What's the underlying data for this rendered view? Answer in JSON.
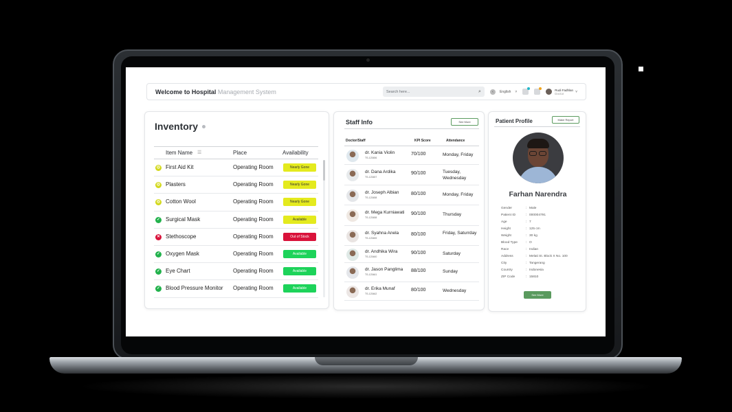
{
  "header": {
    "welcome": "Welcome to Hospital",
    "welcome_sub": "Management System",
    "search_placeholder": "Search here...",
    "language": "English",
    "user_name": "Rudi Fadhlan",
    "user_role": "Doctor"
  },
  "inventory": {
    "title": "Inventory",
    "col_item": "Item Name",
    "col_place": "Place",
    "col_availability": "Availability",
    "items": [
      {
        "name": "First Aid Kit",
        "place": "Operating Room",
        "status": "Nearly Gone",
        "status_color": "#e4ea1e",
        "text_color": "#333333",
        "icon": "warning-circle-icon",
        "icon_color": "#d2d81a",
        "icon_glyph": "◎"
      },
      {
        "name": "Plasters",
        "place": "Operating Room",
        "status": "Nearly Gone",
        "status_color": "#e4ea1e",
        "text_color": "#333333",
        "icon": "warning-circle-icon",
        "icon_color": "#d2d81a",
        "icon_glyph": "◎"
      },
      {
        "name": "Cotton Wool",
        "place": "Operating Room",
        "status": "Nearly Gone",
        "status_color": "#e4ea1e",
        "text_color": "#333333",
        "icon": "warning-circle-icon",
        "icon_color": "#d2d81a",
        "icon_glyph": "◎"
      },
      {
        "name": "Surgical Mask",
        "place": "Operating Room",
        "status": "Available",
        "status_color": "#e4ea1e",
        "text_color": "#333333",
        "icon": "check-circle-icon",
        "icon_color": "#22b24c",
        "icon_glyph": "✓"
      },
      {
        "name": "Stethoscope",
        "place": "Operating Room",
        "status": "Out of Stock",
        "status_color": "#d9123a",
        "text_color": "#ffffff",
        "icon": "x-circle-icon",
        "icon_color": "#d9123a",
        "icon_glyph": "✕"
      },
      {
        "name": "Oxygen Mask",
        "place": "Operating Room",
        "status": "Available",
        "status_color": "#1dd35a",
        "text_color": "#ffffff",
        "icon": "check-circle-icon",
        "icon_color": "#22b24c",
        "icon_glyph": "✓"
      },
      {
        "name": "Eye Chart",
        "place": "Operating Room",
        "status": "Available",
        "status_color": "#1dd35a",
        "text_color": "#ffffff",
        "icon": "check-circle-icon",
        "icon_color": "#22b24c",
        "icon_glyph": "✓"
      },
      {
        "name": "Blood Pressure Monitor",
        "place": "Operating Room",
        "status": "Available",
        "status_color": "#1dd35a",
        "text_color": "#ffffff",
        "icon": "check-circle-icon",
        "icon_color": "#22b24c",
        "icon_glyph": "✓"
      }
    ]
  },
  "staff": {
    "title": "Staff Info",
    "see_more": "See More",
    "col_doctor": "Doctor/Staff",
    "col_kpi": "KPI Score",
    "col_attendance": "Attendance",
    "rows": [
      {
        "name": "dr. Kania Violin",
        "id": "TS-123456",
        "kpi": "70/100",
        "attendance": "Monday, Friday"
      },
      {
        "name": "dr. Dana Ardika",
        "id": "TS-123457",
        "kpi": "90/100",
        "attendance": "Tuesday, Wednesday"
      },
      {
        "name": "dr. Joseph Albian",
        "id": "TS-123458",
        "kpi": "80/100",
        "attendance": "Monday, Friday"
      },
      {
        "name": "dr. Mega Kurniawati",
        "id": "TS-123458",
        "kpi": "90/100",
        "attendance": "Thursday"
      },
      {
        "name": "dr. Syahna Anela",
        "id": "TS-123459",
        "kpi": "80/100",
        "attendance": "Friday, Saturrday"
      },
      {
        "name": "dr. Andhika Wira",
        "id": "TS-123460",
        "kpi": "90/100",
        "attendance": "Saturday"
      },
      {
        "name": "dr. Jason Panglima",
        "id": "TS-123461",
        "kpi": "88/100",
        "attendance": "Sunday"
      },
      {
        "name": "dr. Erika Munaf",
        "id": "TS-123462",
        "kpi": "80/100",
        "attendance": "Wednesday"
      }
    ]
  },
  "patient": {
    "title": "Patient Profile",
    "make_report": "Make Report",
    "name": "Farhan Narendra",
    "see_more": "See More",
    "fields": [
      {
        "k": "Gender",
        "v": "Male"
      },
      {
        "k": "Patient ID",
        "v": "000004791"
      },
      {
        "k": "Age",
        "v": "7"
      },
      {
        "k": "Height",
        "v": "125 cm"
      },
      {
        "k": "Weight",
        "v": "30 kg"
      },
      {
        "k": "Blood Type",
        "v": "O"
      },
      {
        "k": "Race",
        "v": "Indian"
      },
      {
        "k": "Address",
        "v": "Melati St. Block X No. 100"
      },
      {
        "k": "City",
        "v": "Tangerang"
      },
      {
        "k": "Country",
        "v": "Indonesia"
      },
      {
        "k": "ZIP Code",
        "v": "15810"
      }
    ]
  }
}
